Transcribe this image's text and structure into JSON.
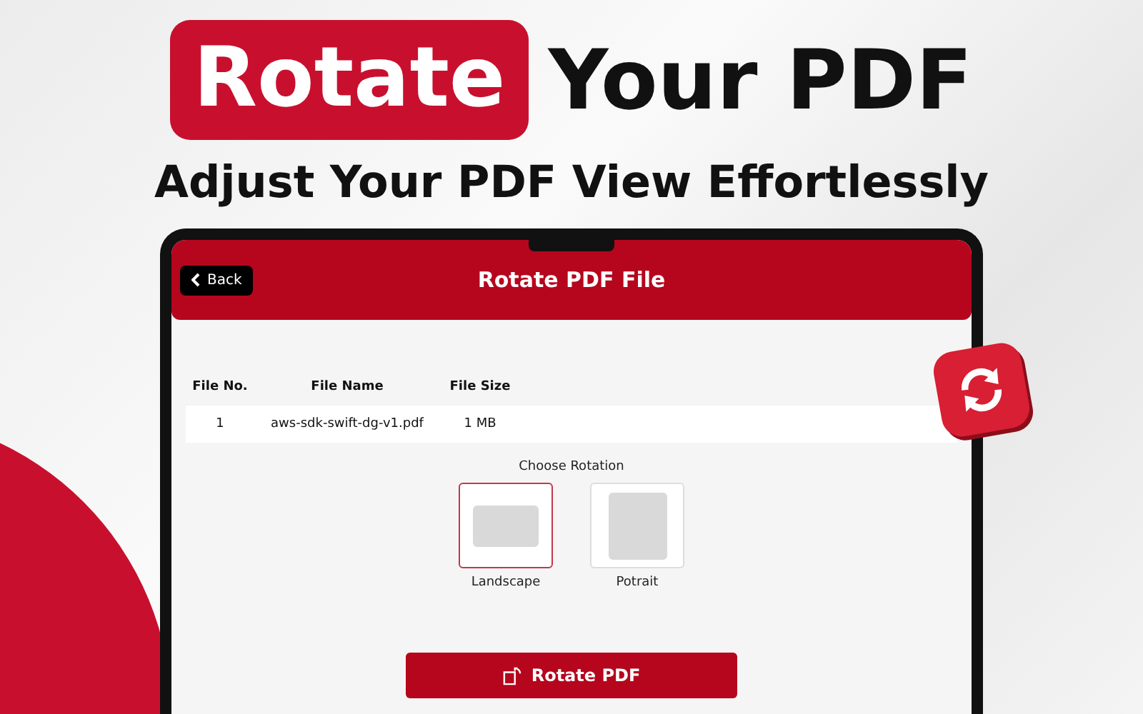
{
  "headline": {
    "highlight": "Rotate",
    "rest": "Your PDF"
  },
  "subtitle": "Adjust Your PDF View Effortlessly",
  "app": {
    "back_button": "Back",
    "title": "Rotate PDF File",
    "table": {
      "columns": [
        "File No.",
        "File Name",
        "File Size"
      ],
      "rows": [
        [
          "1",
          "aws-sdk-swift-dg-v1.pdf",
          "1 MB"
        ]
      ]
    },
    "rotation": {
      "label": "Choose Rotation",
      "options": [
        {
          "label": "Landscape",
          "kind": "landscape",
          "selected": true
        },
        {
          "label": "Potrait",
          "kind": "portrait",
          "selected": false
        }
      ]
    },
    "action_button": "Rotate PDF"
  }
}
